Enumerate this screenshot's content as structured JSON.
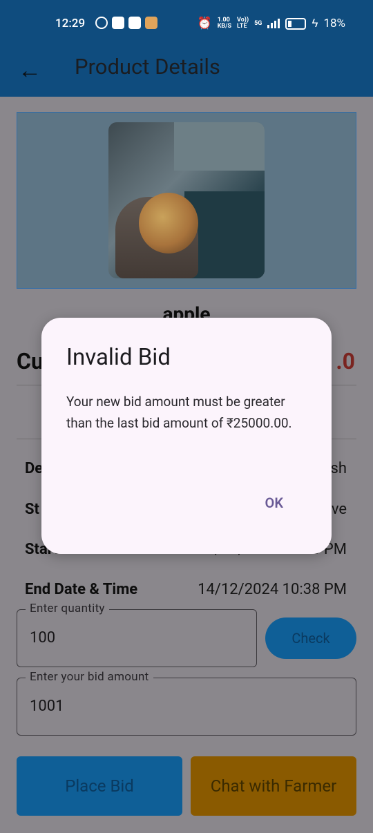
{
  "status_bar": {
    "time": "12:29",
    "network_speed": "1.00",
    "network_unit": "KB/S",
    "volte": "Vo))",
    "lte": "LTE",
    "five_g": "5G",
    "battery_percent": "18%"
  },
  "app_bar": {
    "back_icon": "arrow-left-icon",
    "title": "Product Details"
  },
  "product": {
    "name": "apple",
    "price_label_partial": "Cu",
    "price_value_partial": ".0"
  },
  "details": [
    {
      "label": "De",
      "value": "sh"
    },
    {
      "label": "St",
      "value": "ve"
    },
    {
      "label": "Start Date",
      "value": "14/12/2024 10:38 PM"
    },
    {
      "label": "End Date & Time",
      "value": "14/12/2024 10:38 PM"
    }
  ],
  "quantity_field": {
    "legend": "Enter quantity",
    "value": "100"
  },
  "check_button": {
    "label": "Check"
  },
  "bid_field": {
    "legend": "Enter your bid amount",
    "value": "1001"
  },
  "place_bid_button": {
    "label": "Place Bid"
  },
  "chat_button": {
    "label": "Chat with Farmer"
  },
  "dialog": {
    "title": "Invalid Bid",
    "message": "Your new bid amount must be greater than the last bid amount of ₹25000.00.",
    "ok_label": "OK"
  },
  "colors": {
    "app_bar": "#0f4c7e",
    "primary_button": "#0f5f97",
    "chat_button": "#8a5a00",
    "price_red": "#7a2420",
    "dialog_bg": "#fcf4fc",
    "dialog_action": "#6a5a96"
  }
}
